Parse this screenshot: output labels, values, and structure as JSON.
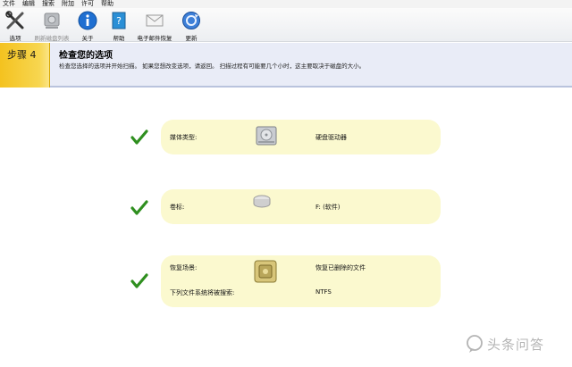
{
  "menu": [
    "文件",
    "编辑",
    "搜索",
    "附加",
    "许可",
    "帮助"
  ],
  "toolbar": {
    "options": "选项",
    "refresh": "刷新磁盘列表",
    "about": "关于",
    "help": "帮助",
    "email": "电子邮件恢复",
    "update": "更新"
  },
  "step": {
    "label": "步骤 4",
    "title": "检查您的选项",
    "description": "检查您选择的选项并开始扫描。 如果您想改变选项，请返回。 扫描过程有可能要几个小时，这主要取决于磁盘的大小。"
  },
  "options": {
    "media_label": "媒体类型:",
    "media_value": "硬盘驱动器",
    "volume_label": "卷标:",
    "volume_value": "F: (软件)",
    "scenario_label": "恢复场景:",
    "scenario_value": "恢复已删除的文件",
    "fs_label": "下列文件系统将被搜索:",
    "fs_value": "NTFS"
  },
  "watermark": "头条问答",
  "colors": {
    "panel": "#fbf9cf",
    "check": "#2f8f1f",
    "step_accent": "#f4c21f",
    "header_bg": "#e9ecf7"
  }
}
